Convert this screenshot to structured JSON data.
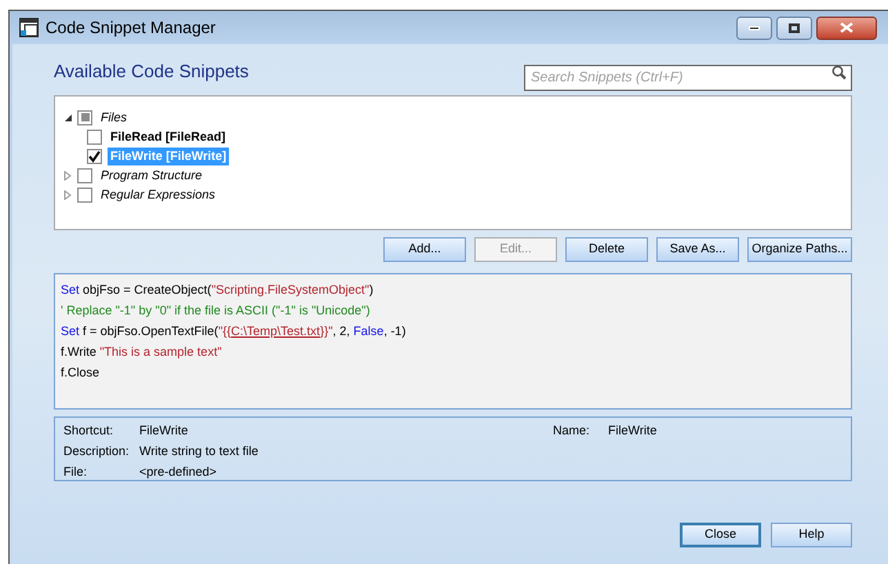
{
  "window": {
    "title": "Code Snippet Manager"
  },
  "heading": "Available Code Snippets",
  "search": {
    "placeholder": "Search Snippets (Ctrl+F)"
  },
  "tree": [
    {
      "label": "Files",
      "kind": "category",
      "partial": true,
      "expanded": true,
      "selected": false,
      "children": [
        {
          "label": "FileRead [FileRead]",
          "kind": "snippet",
          "checked": false,
          "selected": false
        },
        {
          "label": "FileWrite [FileWrite]",
          "kind": "snippet",
          "checked": true,
          "selected": true
        }
      ]
    },
    {
      "label": "Program Structure",
      "kind": "category",
      "checked": false,
      "expanded": false,
      "selected": false
    },
    {
      "label": "Regular Expressions",
      "kind": "category",
      "checked": false,
      "expanded": false,
      "selected": false
    }
  ],
  "buttons": [
    {
      "label": "Add...",
      "disabled": false
    },
    {
      "label": "Edit...",
      "disabled": true
    },
    {
      "label": "Delete",
      "disabled": false
    },
    {
      "label": "Save As...",
      "disabled": false
    },
    {
      "label": "Organize Paths...",
      "disabled": false
    }
  ],
  "code": [
    [
      {
        "kind": "keyword",
        "text": "Set"
      },
      {
        "kind": "plain",
        "text": " objFso = CreateObject("
      },
      {
        "kind": "string",
        "text": "\"Scripting.FileSystemObject\""
      },
      {
        "kind": "plain",
        "text": ")"
      }
    ],
    [
      {
        "kind": "comment",
        "text": "' Replace \"-1\" by \"0\" if the file is ASCII (\"-1\" is \"Unicode\")"
      }
    ],
    [
      {
        "kind": "keyword",
        "text": "Set"
      },
      {
        "kind": "plain",
        "text": " f = objFso.OpenTextFile("
      },
      {
        "kind": "string",
        "text": "\"{{"
      },
      {
        "kind": "link",
        "text": "C:\\Temp\\Test.txt"
      },
      {
        "kind": "string",
        "text": "}}\""
      },
      {
        "kind": "plain",
        "text": ", 2, "
      },
      {
        "kind": "keyword",
        "text": "False"
      },
      {
        "kind": "plain",
        "text": ", -1)"
      }
    ],
    [
      {
        "kind": "plain",
        "text": "f.Write "
      },
      {
        "kind": "string",
        "text": "\"This is a sample text\""
      }
    ],
    [
      {
        "kind": "plain",
        "text": "f.Close"
      }
    ]
  ],
  "details": {
    "shortcut_label": "Shortcut:",
    "shortcut": "FileWrite",
    "name_label": "Name:",
    "name": "FileWrite",
    "description_label": "Description:",
    "description": "Write string to text file",
    "file_label": "File:",
    "file": "<pre-defined>"
  },
  "footer_buttons": [
    {
      "label": "Close",
      "default": true
    },
    {
      "label": "Help",
      "default": false
    }
  ]
}
